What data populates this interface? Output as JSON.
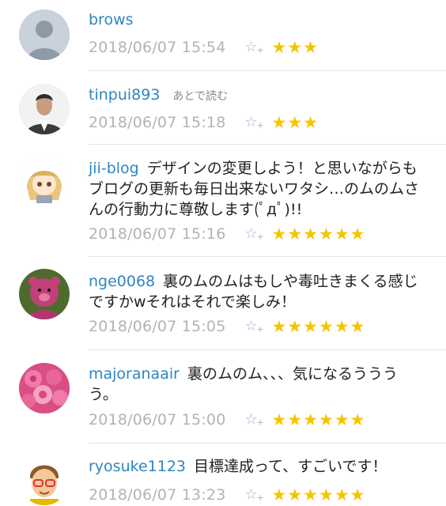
{
  "comments": [
    {
      "user": "brows",
      "later": "",
      "text": "",
      "time": "2018/06/07 15:54",
      "stars": "★★★",
      "star_count": 3,
      "avatar": "default-person-avatar"
    },
    {
      "user": "tinpui893",
      "later": "あとで読む",
      "text": "",
      "time": "2018/06/07 15:18",
      "stars": "★★★",
      "star_count": 3,
      "avatar": "man-photo-avatar"
    },
    {
      "user": "jii-blog",
      "later": "",
      "text": "デザインの変更しよう！と思いながらもブログの更新も毎日出来ないワタシ…のムのムさんの行動力に尊敬します(ﾟдﾟ)!!",
      "time": "2018/06/07 15:16",
      "stars": "★★★★★★",
      "star_count": 6,
      "avatar": "anime-girl-avatar"
    },
    {
      "user": "nge0068",
      "later": "",
      "text": "裏のムのムはもしや毒吐きまくる感じですかwそれはそれで楽しみ！",
      "time": "2018/06/07 15:05",
      "stars": "★★★★★★",
      "star_count": 6,
      "avatar": "pink-bear-avatar"
    },
    {
      "user": "majoranaair",
      "later": "",
      "text": "裏のムのム、、、気になるうううう。",
      "time": "2018/06/07 15:00",
      "stars": "★★★★★★",
      "star_count": 6,
      "avatar": "roses-avatar"
    },
    {
      "user": "ryosuke1123",
      "later": "",
      "text": "目標達成って、すごいです！",
      "time": "2018/06/07 13:23",
      "stars": "★★★★★★",
      "star_count": 6,
      "avatar": "cartoon-boy-avatar"
    }
  ],
  "add_star_icon": "☆",
  "add_star_plus": "+",
  "colors": {
    "username": "#2e86c1",
    "timestamp": "#b3b3b3",
    "star": "#f5c400",
    "add_star": "#9fb3d6"
  }
}
